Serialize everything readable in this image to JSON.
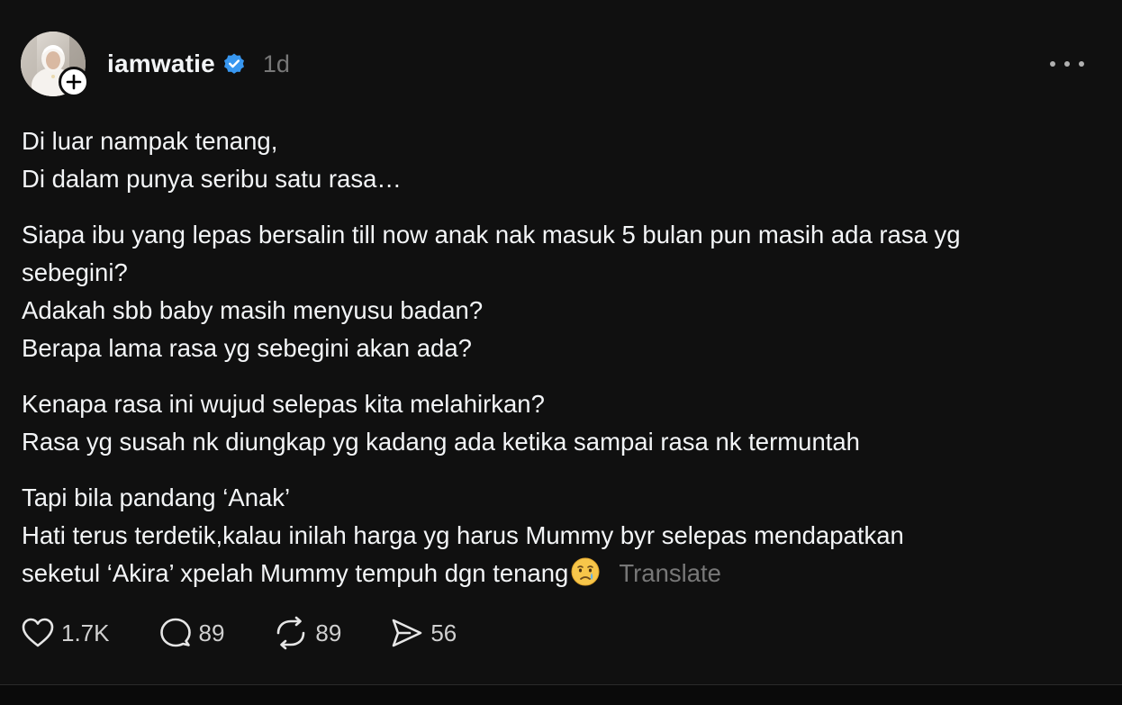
{
  "post": {
    "username": "iamwatie",
    "timestamp": "1d",
    "paragraphs": [
      [
        "Di luar nampak tenang,",
        "Di dalam punya seribu satu rasa…"
      ],
      [
        "Siapa ibu yang lepas bersalin till now anak nak masuk 5 bulan pun masih ada rasa yg",
        "sebegini?",
        "Adakah sbb baby masih menyusu badan?",
        "Berapa lama rasa yg sebegini akan ada?"
      ],
      [
        "Kenapa rasa ini wujud selepas kita melahirkan?",
        "Rasa yg susah nk diungkap yg kadang ada ketika sampai rasa nk termuntah"
      ],
      [
        "Tapi bila pandang ‘Anak’",
        "Hati terus terdetik,kalau inilah harga yg harus Mummy byr selepas mendapatkan",
        "seketul ‘Akira’ xpelah Mummy tempuh dgn tenang"
      ]
    ],
    "translate_label": "Translate"
  },
  "actions": {
    "likes": "1.7K",
    "comments": "89",
    "reposts": "89",
    "shares": "56"
  },
  "icons": {
    "verified": "verified-badge-icon",
    "follow": "plus-icon",
    "more": "more-horizontal-icon",
    "like": "heart-icon",
    "comment": "comment-icon",
    "repost": "repost-icon",
    "share": "send-icon",
    "emoji": "crying-face-emoji"
  },
  "colors": {
    "background": "#101010",
    "text": "#f3f5f7",
    "muted": "#777777",
    "verified": "#3897f0"
  }
}
